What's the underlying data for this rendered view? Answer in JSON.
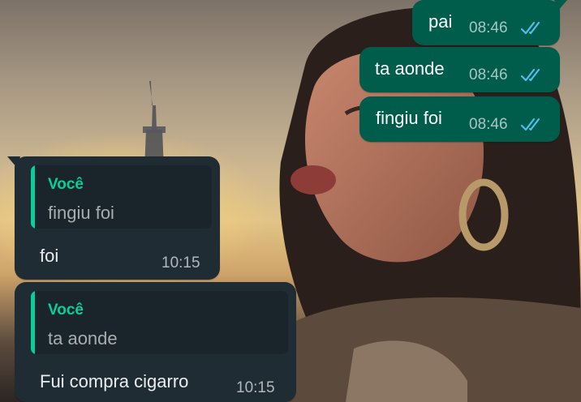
{
  "chat": {
    "outgoing": [
      {
        "text": "pai",
        "time": "08:46",
        "status_icon": "double-check-read-icon"
      },
      {
        "text": "ta aonde",
        "time": "08:46",
        "status_icon": "double-check-read-icon"
      },
      {
        "text": "fingiu foi",
        "time": "08:46",
        "status_icon": "double-check-read-icon"
      }
    ],
    "incoming": [
      {
        "quote_author": "Você",
        "quote_text": "fingiu foi",
        "text": "foi",
        "time": "10:15"
      },
      {
        "quote_author": "Você",
        "quote_text": "ta aonde",
        "text": "Fui compra cigarro",
        "time": "10:15"
      }
    ]
  },
  "colors": {
    "outgoing_bubble": "#005c4b",
    "incoming_bubble": "#1f2c34",
    "quote_accent": "#06cf9c",
    "read_ticks": "#53bdeb"
  }
}
